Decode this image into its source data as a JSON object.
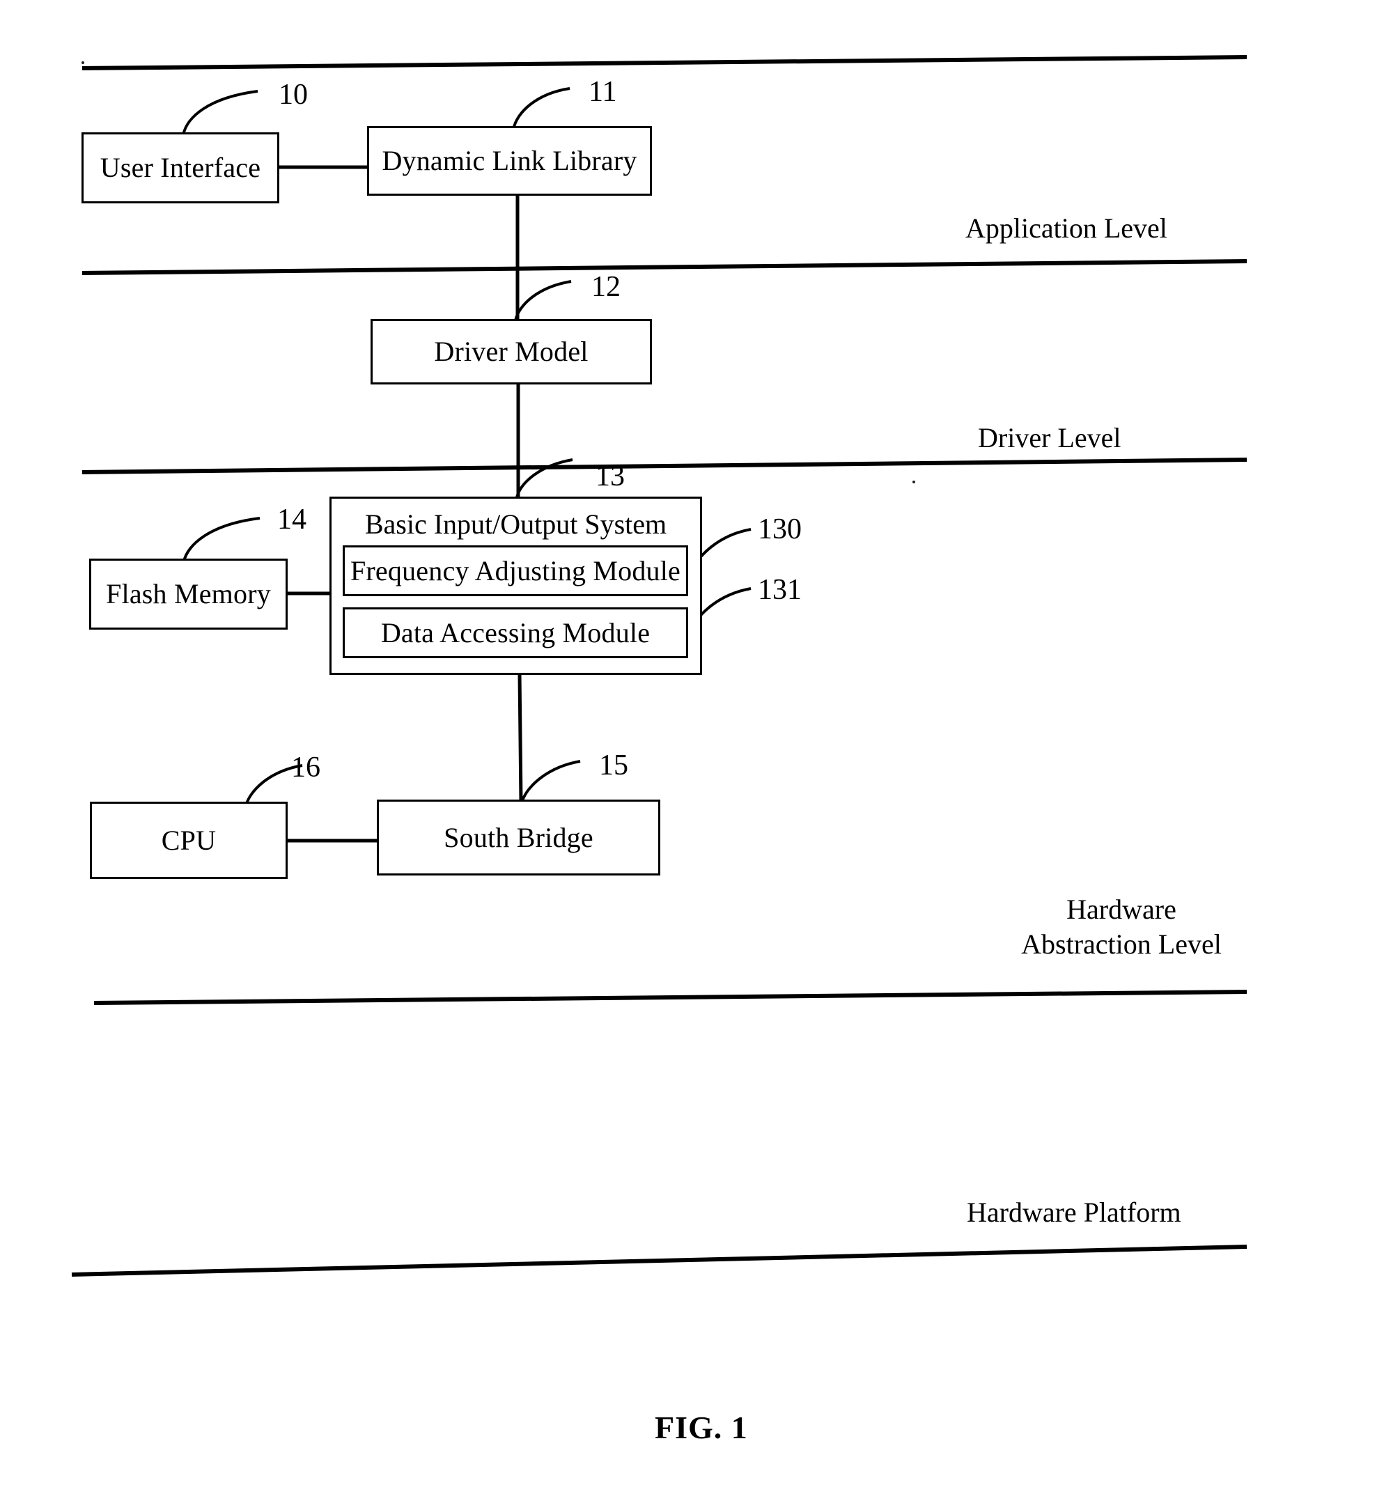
{
  "figure": {
    "caption": "FIG. 1",
    "title": "System architecture block diagram"
  },
  "levels": [
    {
      "id": "application",
      "label": "Application Level"
    },
    {
      "id": "driver",
      "label": "Driver Level"
    },
    {
      "id": "hardware-abstraction",
      "label_line1": "Hardware",
      "label_line2": "Abstraction Level"
    },
    {
      "id": "hardware-platform",
      "label": "Hardware Platform"
    }
  ],
  "blocks": {
    "user_interface": {
      "label": "User Interface",
      "ref": "10"
    },
    "dynamic_link_library": {
      "label": "Dynamic Link Library",
      "ref": "11"
    },
    "driver_model": {
      "label": "Driver Model",
      "ref": "12"
    },
    "bios": {
      "label": "Basic Input/Output System",
      "ref": "13"
    },
    "frequency_adjusting_module": {
      "label": "Frequency Adjusting Module",
      "ref": "130"
    },
    "data_accessing_module": {
      "label": "Data Accessing Module",
      "ref": "131"
    },
    "flash_memory": {
      "label": "Flash Memory",
      "ref": "14"
    },
    "south_bridge": {
      "label": "South Bridge",
      "ref": "15"
    },
    "cpu": {
      "label": "CPU",
      "ref": "16"
    }
  },
  "colors": {
    "line": "#000000",
    "background": "#ffffff"
  }
}
